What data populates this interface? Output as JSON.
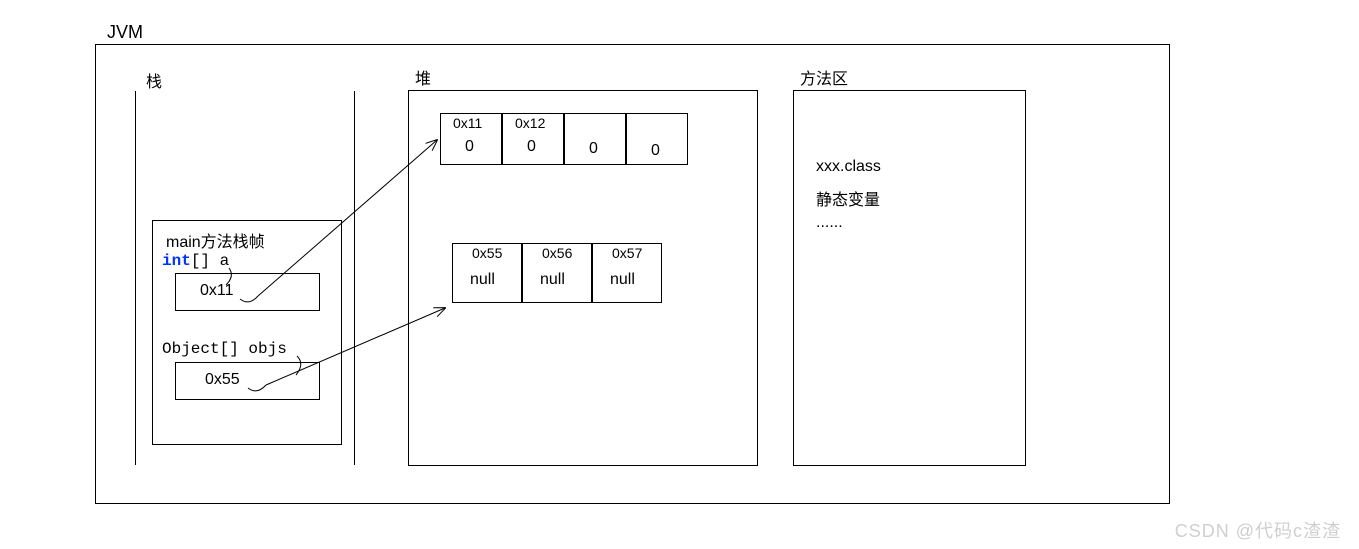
{
  "title": "JVM",
  "stack": {
    "label": "栈",
    "frame_label": "main方法栈帧",
    "var1_type": "int",
    "var1_name": "[] a",
    "var1_value": "0x11",
    "var2_decl": "Object[] objs",
    "var2_value": "0x55"
  },
  "heap": {
    "label": "堆",
    "arr1": {
      "addrs": [
        "0x11",
        "0x12",
        "",
        ""
      ],
      "vals": [
        "0",
        "0",
        "0",
        "0"
      ]
    },
    "arr2": {
      "addrs": [
        "0x55",
        "0x56",
        "0x57"
      ],
      "vals": [
        "null",
        "null",
        "null"
      ]
    }
  },
  "method_area": {
    "label": "方法区",
    "line1": "xxx.class",
    "line2": "静态变量",
    "line3": "......"
  },
  "watermark": "CSDN @代码c渣渣"
}
